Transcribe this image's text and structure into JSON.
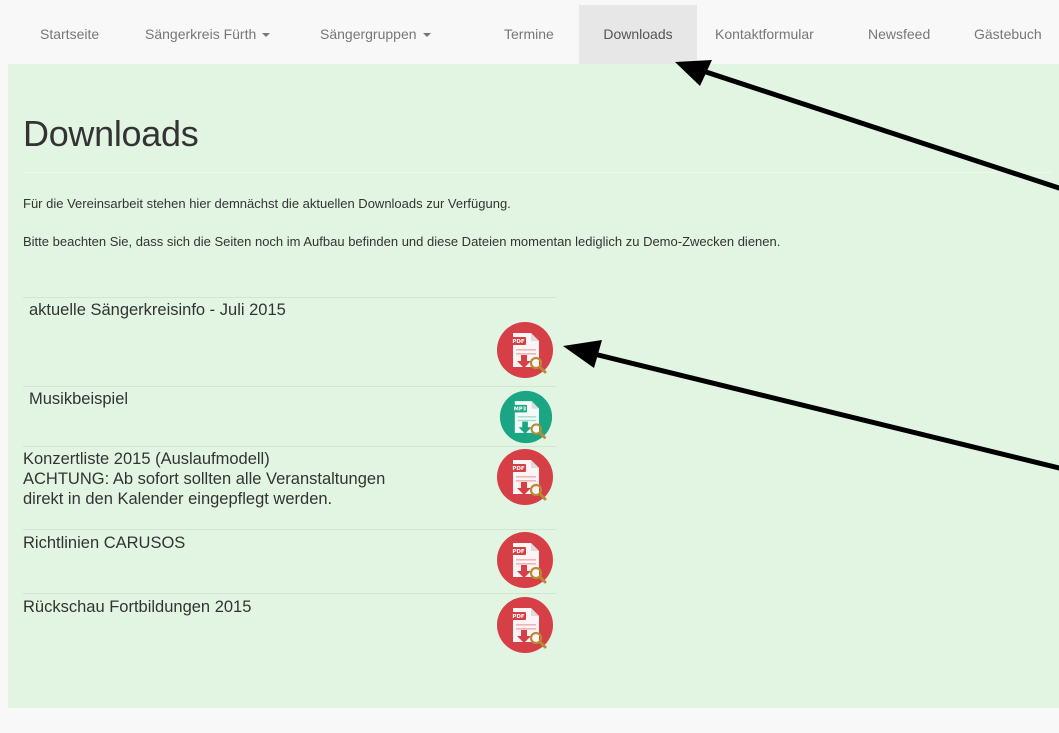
{
  "nav": {
    "items": [
      {
        "label": "Startseite",
        "dropdown": false,
        "active": false
      },
      {
        "label": "Sängerkreis Fürth",
        "dropdown": true,
        "active": false
      },
      {
        "label": "Sängergruppen",
        "dropdown": true,
        "active": false
      },
      {
        "label": "Termine",
        "dropdown": false,
        "active": false
      },
      {
        "label": "Downloads",
        "dropdown": false,
        "active": true
      },
      {
        "label": "Kontaktformular",
        "dropdown": false,
        "active": false
      },
      {
        "label": "Newsfeed",
        "dropdown": false,
        "active": false
      },
      {
        "label": "Gästebuch",
        "dropdown": false,
        "active": false
      }
    ]
  },
  "page": {
    "title": "Downloads",
    "intro1": "Für die Vereinsarbeit stehen hier demnächst die aktuellen Downloads zur Verfügung.",
    "intro2": "Bitte beachten Sie, dass sich die Seiten noch im Aufbau befinden und diese Dateien momentan lediglich zu Demo-Zwecken dienen."
  },
  "downloads": [
    {
      "lines": [
        "aktuelle Sängerkreisinfo - Juli 2015"
      ],
      "type": "PDF",
      "color": "#d63f45"
    },
    {
      "lines": [
        "Musikbeispiel"
      ],
      "type": "MP3",
      "color": "#1aa584"
    },
    {
      "lines": [
        "Konzertliste 2015 (Auslaufmodell)",
        "ACHTUNG: Ab sofort sollten alle Veranstaltungen",
        "direkt in den Kalender eingepflegt werden."
      ],
      "type": "PDF",
      "color": "#d63f45"
    },
    {
      "lines": [
        "Richtlinien CARUSOS"
      ],
      "type": "PDF",
      "color": "#d63f45"
    },
    {
      "lines": [
        "Rückschau Fortbildungen 2015"
      ],
      "type": "PDF",
      "color": "#d63f45"
    }
  ],
  "colors": {
    "content_bg": "#e2f5e2",
    "nav_active_bg": "#e7e7e7",
    "annotation_arrow": "#000000"
  }
}
